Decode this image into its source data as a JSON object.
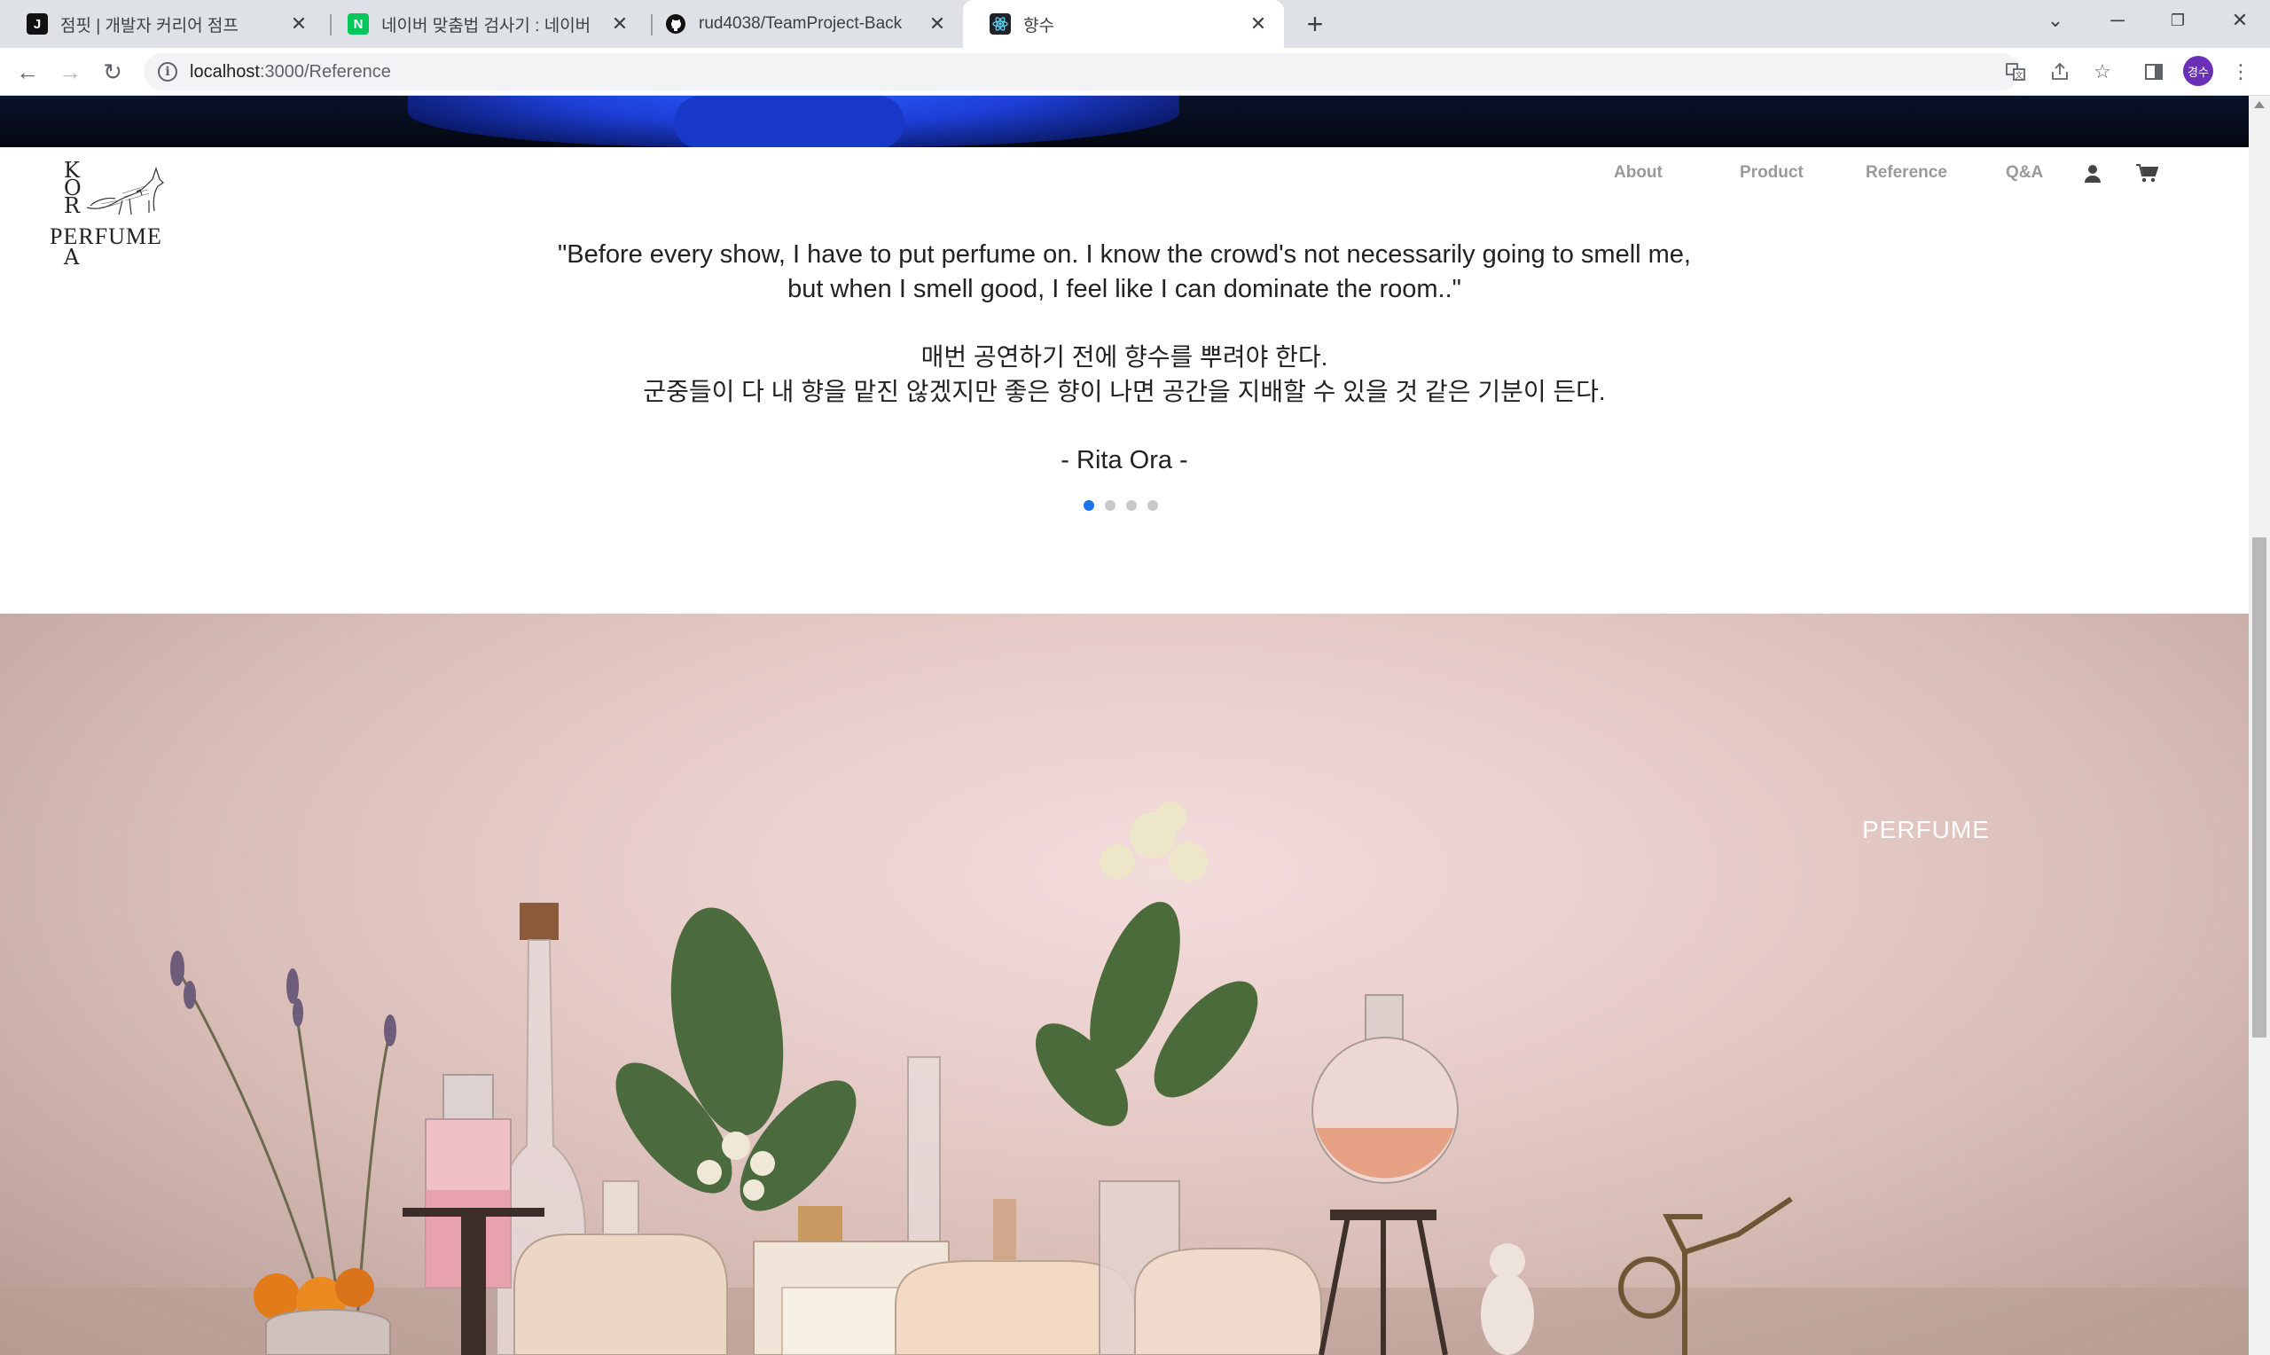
{
  "browser": {
    "tabs": [
      {
        "title": "점핏 | 개발자 커리어 점프",
        "favicon": "J",
        "favicon_color": "#111111"
      },
      {
        "title": "네이버 맞춤법 검사기 : 네이버",
        "favicon": "N",
        "favicon_color": "#03c75a"
      },
      {
        "title": "rud4038/TeamProject-Back",
        "favicon": "github-icon",
        "favicon_color": "#111111"
      },
      {
        "title": "향수",
        "favicon": "react-icon",
        "favicon_color": "#20232a"
      }
    ],
    "active_tab": 3,
    "url_host": "localhost",
    "url_path": ":3000/Reference",
    "profile_initials": "경수"
  },
  "site": {
    "logo": {
      "letters": [
        "K",
        "O",
        "R",
        "A"
      ],
      "word": "PERFUME"
    },
    "nav": [
      "About",
      "Product",
      "Reference",
      "Q&A"
    ]
  },
  "testimonial": {
    "quote_en_line1": "\"Before every show, I have to put perfume on. I know the crowd's not necessarily going to smell me,",
    "quote_en_line2": "but when I smell good, I feel like I can dominate the room..\"",
    "quote_ko_line1": "매번 공연하기 전에 향수를 뿌려야 한다.",
    "quote_ko_line2": "군중들이 다 내 향을 맡진 않겠지만 좋은 향이 나면 공간을 지배할 수 있을 것 같은 기분이 든다.",
    "author": "- Rita Ora -",
    "slides": 4,
    "active_slide": 0
  },
  "banner": {
    "label": "PERFUME"
  },
  "colors": {
    "accent": "#1a73e8",
    "nav_text": "#9a9a9a",
    "profile": "#6a2fb5"
  }
}
